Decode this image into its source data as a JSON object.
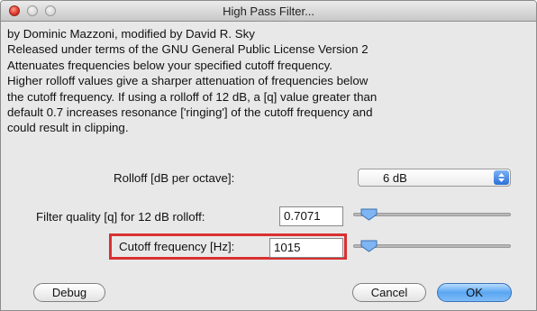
{
  "window": {
    "title": "High Pass Filter..."
  },
  "description": {
    "lines": [
      "by Dominic Mazzoni, modified by David R. Sky",
      "Released under terms of the GNU General Public License Version 2",
      "Attenuates frequencies below your specified cutoff frequency.",
      "Higher rolloff values give a sharper attenuation of frequencies below",
      "the cutoff frequency. If using a rolloff of 12 dB, a [q] value greater than",
      "default 0.7 increases resonance ['ringing'] of the cutoff frequency and",
      "could result in clipping."
    ]
  },
  "rolloff": {
    "label": "Rolloff [dB per octave]:",
    "selected": "6 dB"
  },
  "quality": {
    "label": "Filter quality [q] for 12 dB rolloff:",
    "value": "0.7071",
    "slider_level": 0.02
  },
  "cutoff": {
    "label": "Cutoff frequency [Hz]:",
    "value": "1015",
    "slider_level": 0.02
  },
  "buttons": {
    "debug": "Debug",
    "cancel": "Cancel",
    "ok": "OK"
  },
  "colors": {
    "highlight": "#d93030",
    "accent": "#5aa6f2"
  }
}
